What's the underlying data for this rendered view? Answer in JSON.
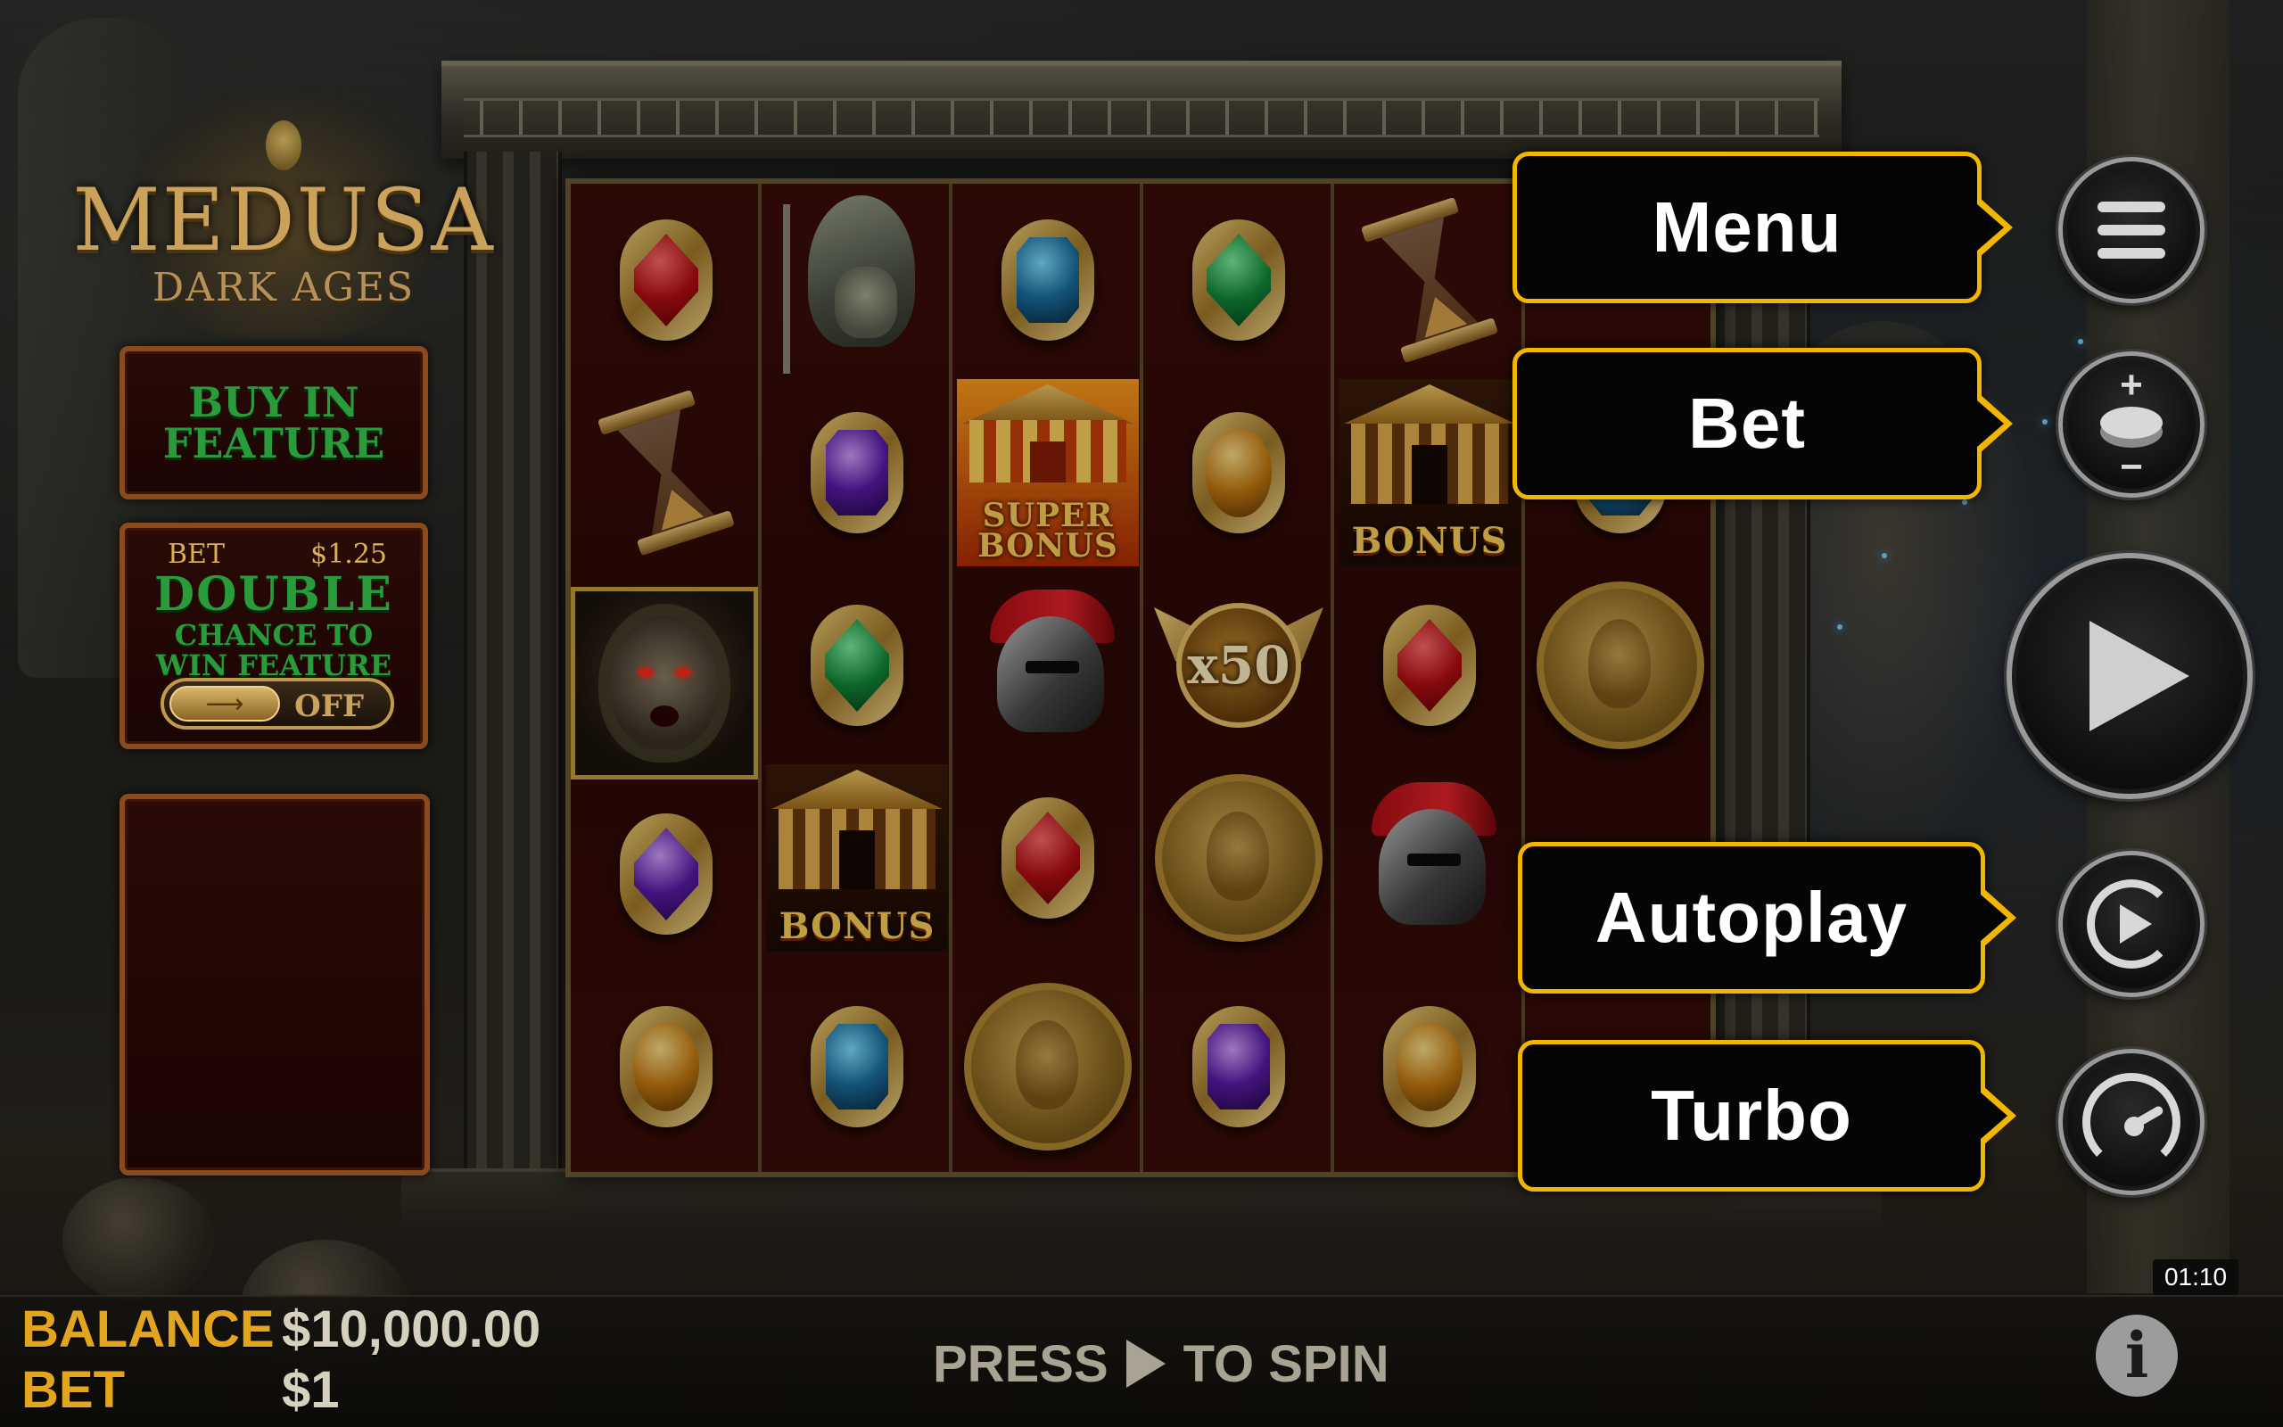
{
  "game": {
    "title": "MEDUSA",
    "subtitle": "DARK AGES"
  },
  "left_panel": {
    "buy_feature": "BUY IN\nFEATURE",
    "double_chance": {
      "bet_label": "BET",
      "bet_amount": "$1.25",
      "headline": "DOUBLE",
      "text": "CHANCE TO\nWIN FEATURE",
      "toggle_arrow": "⟶",
      "toggle_state": "OFF"
    }
  },
  "reels": {
    "symbols": {
      "super_bonus": "SUPER\nBONUS",
      "bonus": "BONUS",
      "multiplier": "x50"
    }
  },
  "controls": {
    "menu": {
      "tooltip": "Menu",
      "icon": "hamburger-icon"
    },
    "bet": {
      "tooltip": "Bet",
      "icon": "coin-stack-icon",
      "plus": "+",
      "minus": "−"
    },
    "spin": {
      "icon": "play-icon"
    },
    "autoplay": {
      "tooltip": "Autoplay",
      "icon": "autoplay-icon"
    },
    "turbo": {
      "tooltip": "Turbo",
      "icon": "speedometer-icon"
    },
    "info": {
      "label": "i",
      "icon": "info-icon"
    }
  },
  "status_bar": {
    "balance_label": "BALANCE",
    "balance_value": "$10,000.00",
    "bet_label": "BET",
    "bet_value": "$1",
    "press_label": "PRESS",
    "to_spin_label": "TO SPIN",
    "clock": "01:10"
  },
  "colors": {
    "tooltip_border": "#f2b600",
    "label_gold": "#e3a51e",
    "feature_green": "#2a9b3a"
  }
}
